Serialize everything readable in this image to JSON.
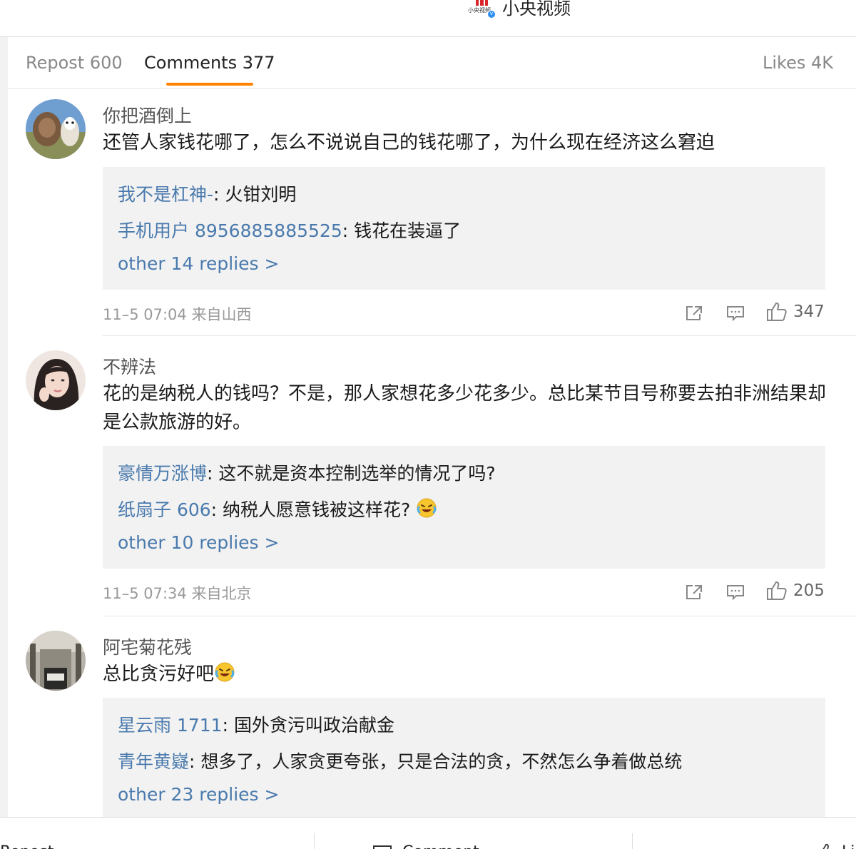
{
  "header": {
    "account_name": "小央视频",
    "logo_text": "小央视频"
  },
  "tabs": {
    "repost": "Repost 600",
    "comments": "Comments 377",
    "likes": "Likes 4K"
  },
  "comments": [
    {
      "username": "你把酒倒上",
      "text": "还管人家钱花哪了，怎么不说说自己的钱花哪了，为什么现在经济这么窘迫",
      "replies": [
        {
          "name": "我不是杠神-",
          "text": ": 火钳刘明"
        },
        {
          "name": "手机用户 8956885885525",
          "text": ": 钱花在装逼了"
        }
      ],
      "more": "other 14 replies >",
      "time": "11–5 07:04 来自山西",
      "likes": "347"
    },
    {
      "username": "不辨法",
      "text": "花的是纳税人的钱吗？不是，那人家想花多少花多少。总比某节目号称要去拍非洲结果却是公款旅游的好。",
      "replies": [
        {
          "name": "豪情万涨博",
          "text": ": 这不就是资本控制选举的情况了吗?"
        },
        {
          "name": "纸扇子 606",
          "text": ": 纳税人愿意钱被这样花? "
        }
      ],
      "more": "other 10 replies >",
      "time": "11–5 07:34 来自北京",
      "likes": "205"
    },
    {
      "username": "阿宅菊花残",
      "text": "总比贪污好吧",
      "replies": [
        {
          "name": "星云雨 1711",
          "text": ": 国外贪污叫政治献金"
        },
        {
          "name": "青年黄嶷",
          "text": ": 想多了，人家贪更夸张，只是合法的贪，不然怎么争着做总统"
        }
      ],
      "more": "other 23 replies >"
    }
  ],
  "bottom_bar": {
    "repost": "Repost",
    "comment": "Comment",
    "like": "Like"
  },
  "colors": {
    "accent_underline": "#ff8200",
    "reply_name": "#4a7aad",
    "verify_badge": "#2f8ff0"
  },
  "icons": [
    "share-icon",
    "comment-icon",
    "thumbs-up-icon",
    "laughing-crying-emoji"
  ]
}
